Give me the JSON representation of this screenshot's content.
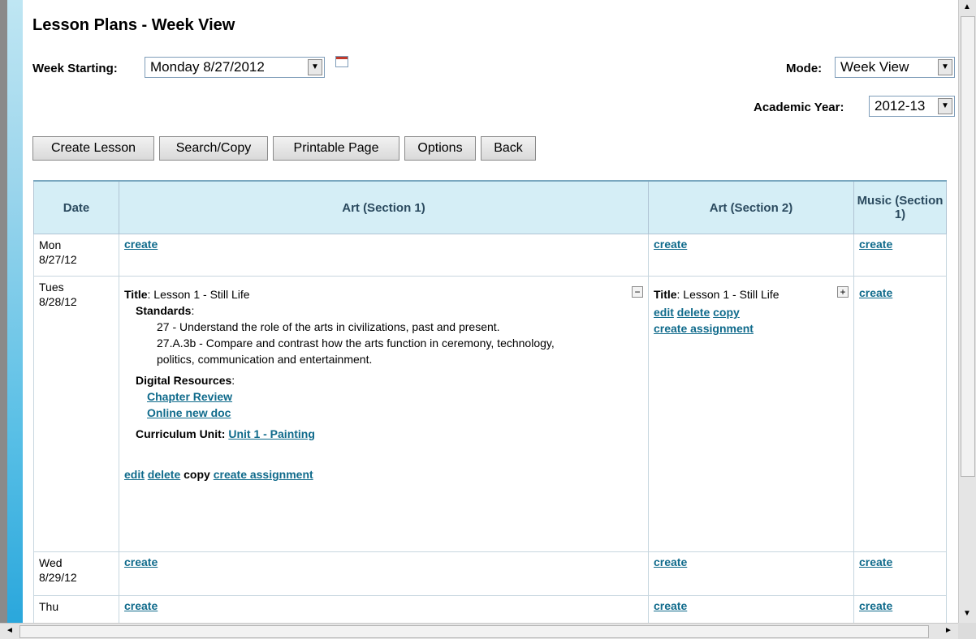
{
  "page": {
    "title": "Lesson Plans - Week View",
    "week_label": "Week Starting:",
    "week_value": "Monday 8/27/2012",
    "mode_label": "Mode:",
    "mode_value": "Week View",
    "year_label": "Academic Year:",
    "year_value": "2012-13"
  },
  "buttons": {
    "create_lesson": "Create Lesson",
    "search_copy": "Search/Copy",
    "printable": "Printable Page",
    "options": "Options",
    "back": "Back"
  },
  "table": {
    "headers": [
      "Date",
      "Art (Section 1)",
      "Art (Section 2)",
      "Music (Section 1)"
    ],
    "rows": [
      {
        "day": "Mon",
        "date": "8/27/12",
        "c1": "create",
        "c2": "create",
        "c3": "create"
      },
      {
        "day": "Tues",
        "date": "8/28/12",
        "c3": "create"
      },
      {
        "day": "Wed",
        "date": "8/29/12",
        "c1": "create",
        "c2": "create",
        "c3": "create"
      },
      {
        "day": "Thu",
        "date": "",
        "c1": "create",
        "c2": "create",
        "c3": "create"
      }
    ]
  },
  "lesson1": {
    "title_label": "Title",
    "title": ": Lesson 1 - Still Life",
    "standards_label": "Standards",
    "standards_colon": ":",
    "standard_a": "27 - Understand the role of the arts in civilizations, past and present.",
    "standard_b": "27.A.3b - Compare and contrast how the arts function in ceremony, technology, politics, communication and entertainment.",
    "digital_label": "Digital Resources",
    "digital_colon": ":",
    "resource_a": "Chapter Review",
    "resource_b": "Online new doc",
    "unit_label": "Curriculum Unit:",
    "unit_value": "Unit 1 - Painting",
    "edit": "edit",
    "delete": "delete",
    "copy": "copy",
    "create_assignment": "create assignment",
    "collapse_symbol": "−"
  },
  "lesson2": {
    "title_label": "Title",
    "title": ": Lesson 1 - Still Life",
    "edit": "edit",
    "delete": "delete",
    "copy": "copy",
    "create_assignment": "create assignment",
    "expand_symbol": "+"
  },
  "scroll": {
    "up": "▲",
    "down": "▼",
    "left": "◄",
    "right": "►"
  }
}
